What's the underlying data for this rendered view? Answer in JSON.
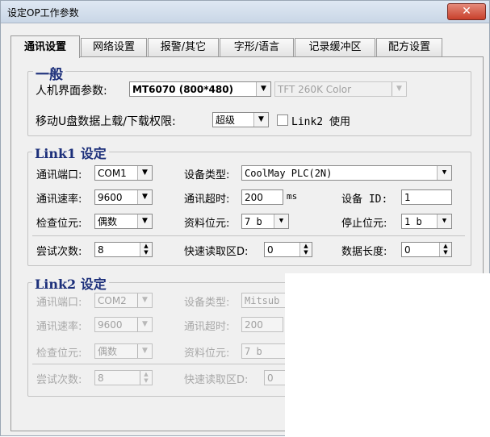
{
  "window": {
    "title": "设定OP工作参数",
    "close_glyph": "✕"
  },
  "tabs": [
    {
      "label": "通讯设置"
    },
    {
      "label": "网络设置"
    },
    {
      "label": "报警/其它"
    },
    {
      "label": "字形/语言"
    },
    {
      "label": "记录缓冲区"
    },
    {
      "label": "配方设置"
    }
  ],
  "general": {
    "title": "一般",
    "hmi_label": "人机界面参数:",
    "hmi_model": "MT6070 (800*480)",
    "display_type": "TFT 260K Color",
    "usb_label": "移动U盘数据上载/下载权限:",
    "usb_permission": "超级",
    "link2_label": "Link2 使用"
  },
  "link1": {
    "title": "Link1 设定",
    "port_label": "通讯端口:",
    "port": "COM1",
    "device_label": "设备类型:",
    "device": "CoolMay PLC(2N)",
    "baud_label": "通讯速率:",
    "baud": "9600",
    "timeout_label": "通讯超时:",
    "timeout": "200",
    "timeout_unit": "ms",
    "id_label": "设备 ID:",
    "id": "1",
    "parity_label": "检查位元:",
    "parity": "偶数",
    "data_bits_label": "资料位元:",
    "data_bits": "7 b",
    "stop_bits_label": "停止位元:",
    "stop_bits": "1 b",
    "retry_label": "尝试次数:",
    "retry": "8",
    "fast_read_label": "快速读取区D:",
    "fast_read": "0",
    "data_len_label": "数据长度:",
    "data_len": "0"
  },
  "link2": {
    "title": "Link2 设定",
    "port_label": "通讯端口:",
    "port": "COM2",
    "device_label": "设备类型:",
    "device": "Mitsub",
    "baud_label": "通讯速率:",
    "baud": "9600",
    "timeout_label": "通讯超时:",
    "timeout": "200",
    "parity_label": "检查位元:",
    "parity": "偶数",
    "data_bits_label": "资料位元:",
    "data_bits": "7 b",
    "retry_label": "尝试次数:",
    "retry": "8",
    "fast_read_label": "快速读取区D:",
    "fast_read": "0"
  },
  "glyphs": {
    "dropdown": "▼",
    "spin_up": "▲",
    "spin_down": "▼"
  },
  "colors": {
    "group_title": "#1c2f7a",
    "disabled_text": "#a8a8a8",
    "close_button": "#c8402c"
  }
}
